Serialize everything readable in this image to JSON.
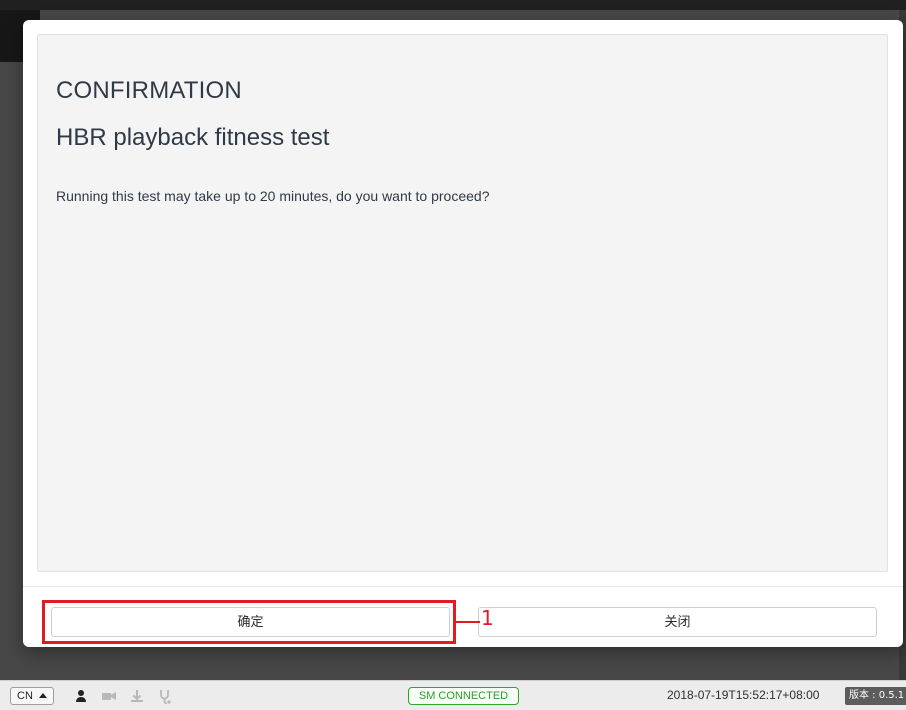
{
  "modal": {
    "title": "CONFIRMATION",
    "subtitle": "HBR playback fitness test",
    "message": "Running this test may take up to 20 minutes, do you want to proceed?",
    "confirm_label": "确定",
    "close_label": "关闭"
  },
  "annotation": {
    "label": "1",
    "color": "#e11b22"
  },
  "statusbar": {
    "language": "CN",
    "sm_status": "SM CONNECTED",
    "timestamp": "2018-07-19T15:52:17+08:00",
    "version": "版本 : 0.5.1",
    "icons": [
      "user-icon",
      "video-icon",
      "download-icon",
      "stethoscope-icon"
    ],
    "status_color": "#29a829"
  }
}
